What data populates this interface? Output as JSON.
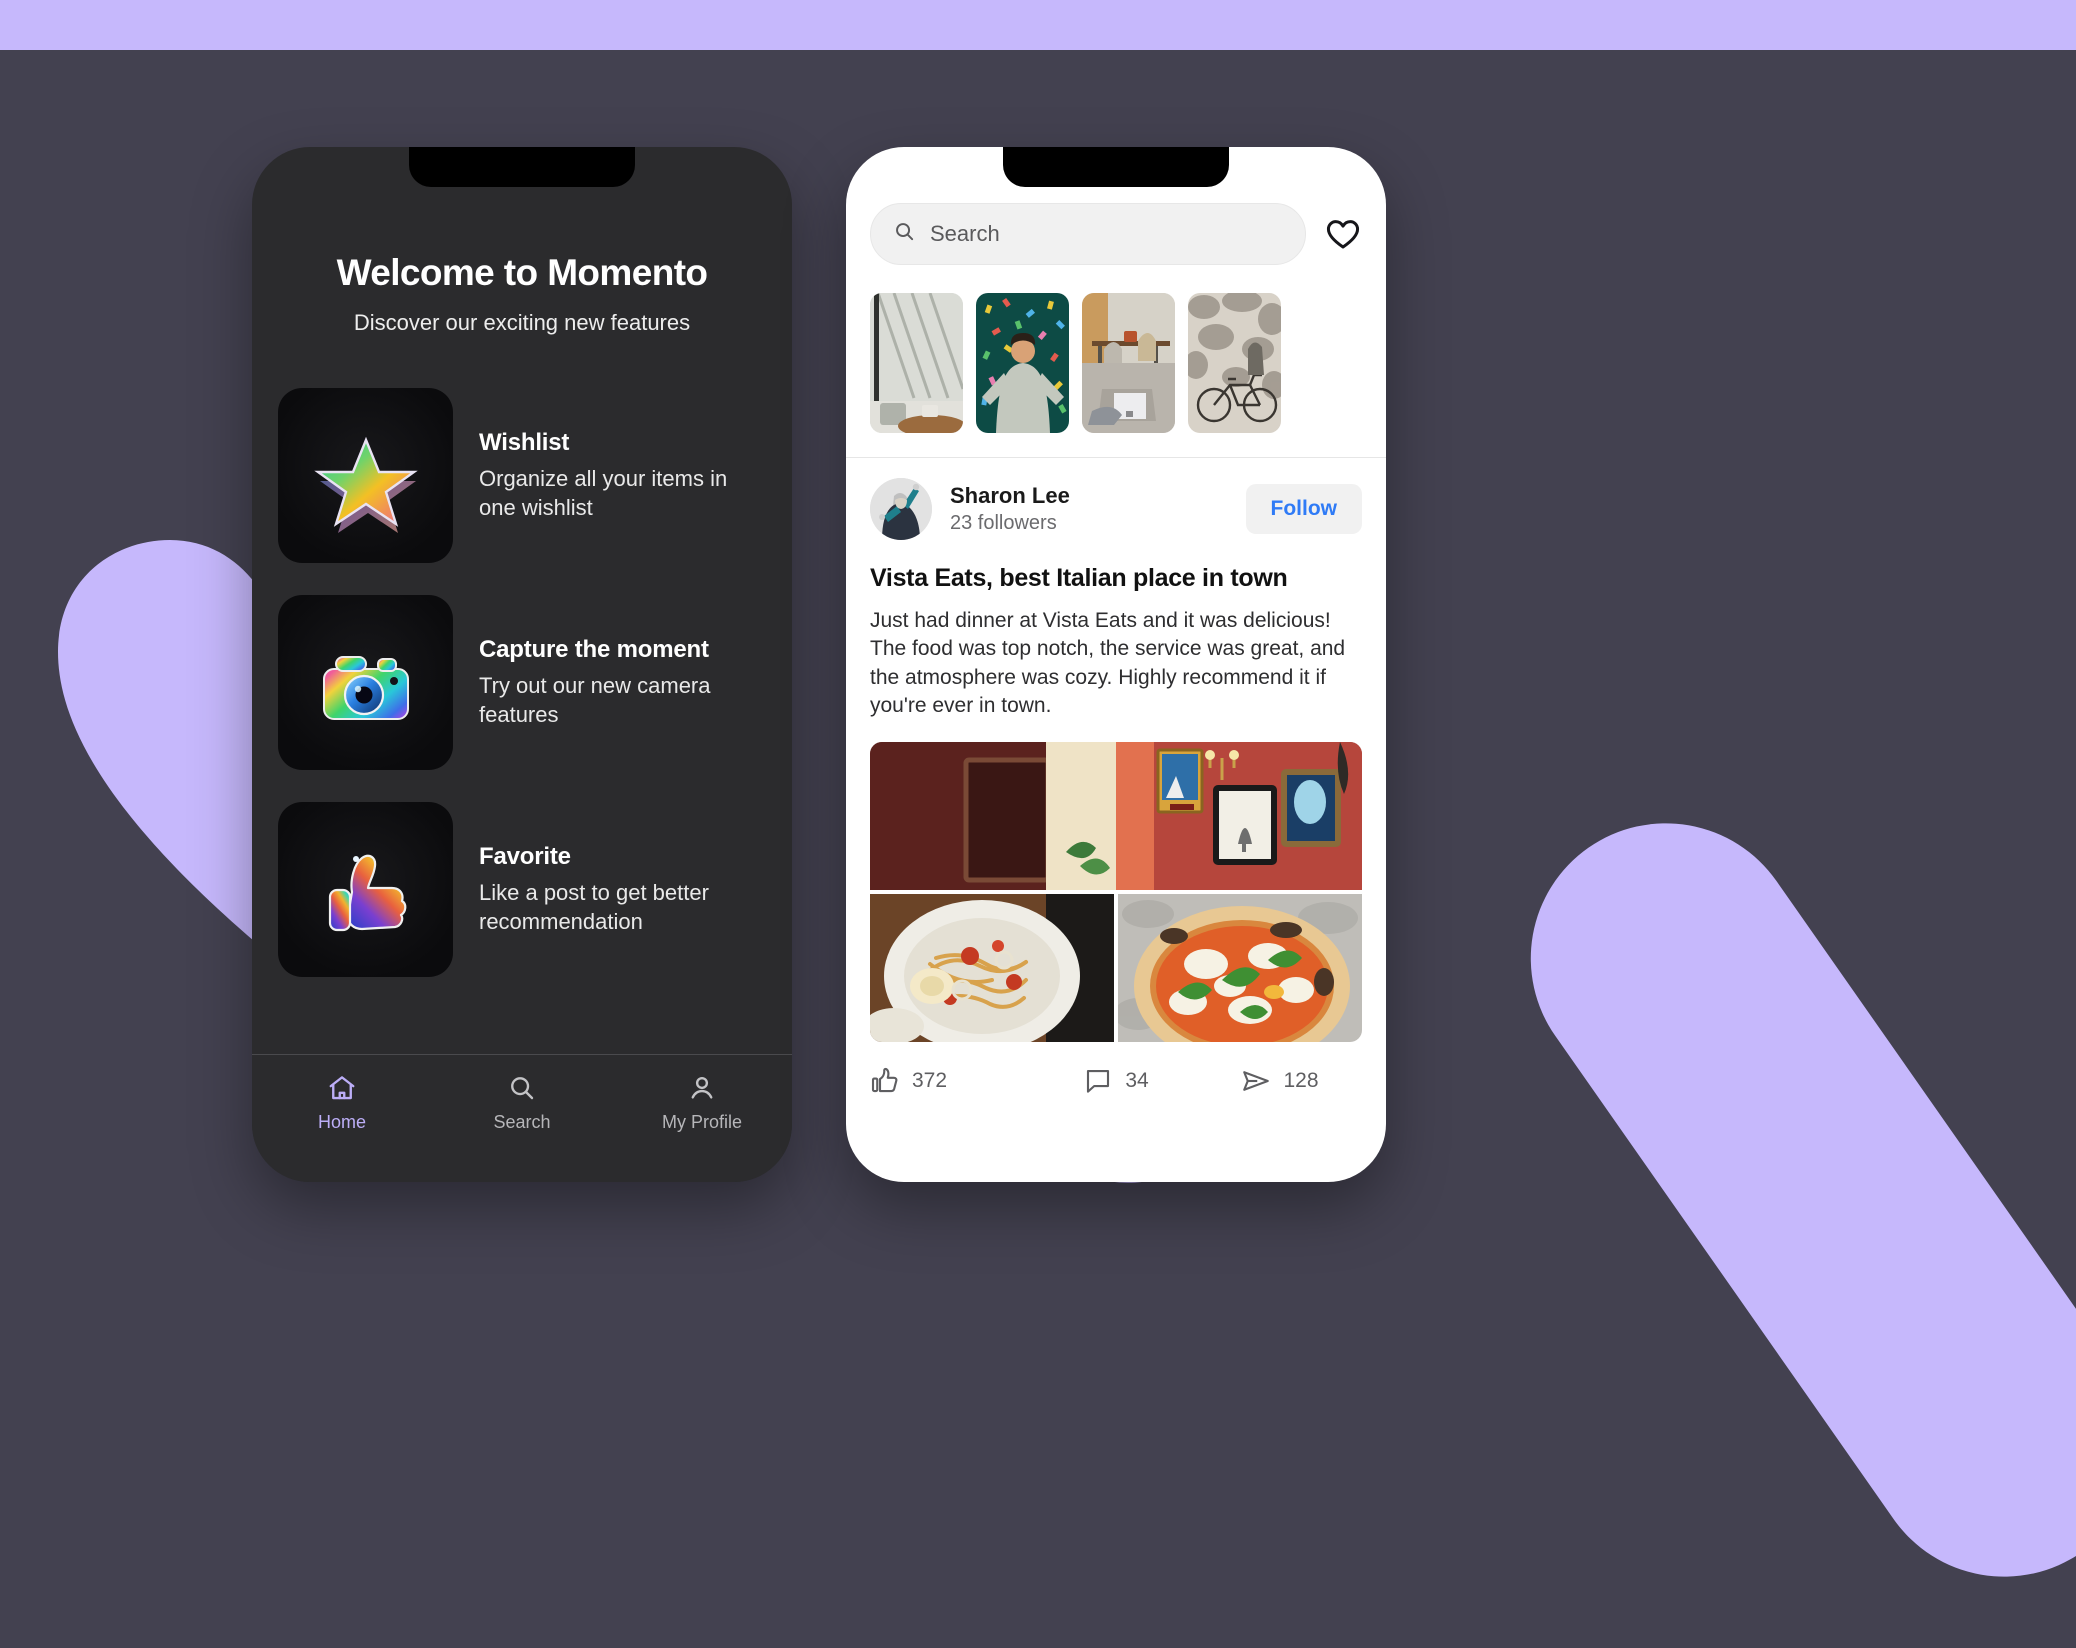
{
  "theme": {
    "page_background": "#434150",
    "accent_purple": "#C6B8FC",
    "dark_phone_bg": "#2B2B2D",
    "light_phone_bg": "#FFFFFF",
    "link_blue": "#2F7BF6",
    "active_tab": "#BCAEF7"
  },
  "onboarding": {
    "title": "Welcome to Momento",
    "subtitle": "Discover our exciting new features",
    "features": [
      {
        "icon": "star-3d-icon",
        "title": "Wishlist",
        "description": "Organize all your items in one wishlist"
      },
      {
        "icon": "camera-3d-icon",
        "title": "Capture the moment",
        "description": "Try out our new camera features"
      },
      {
        "icon": "thumbs-up-3d-icon",
        "title": "Favorite",
        "description": "Like a post to get better recommendation"
      }
    ],
    "tabs": [
      {
        "icon": "home-icon",
        "label": "Home",
        "active": true
      },
      {
        "icon": "search-icon",
        "label": "Search",
        "active": false
      },
      {
        "icon": "person-icon",
        "label": "My Profile",
        "active": false
      }
    ]
  },
  "feed": {
    "search": {
      "icon": "search-icon",
      "placeholder": "Search",
      "value": ""
    },
    "favorites_icon": "heart-outline-icon",
    "stories": [
      {
        "name": "story-window-shadows"
      },
      {
        "name": "story-confetti-person"
      },
      {
        "name": "story-cafe-interior"
      },
      {
        "name": "story-bicycle-wall"
      }
    ],
    "post": {
      "author": {
        "avatar": "avatar-sharon-lee",
        "name": "Sharon Lee",
        "followers": "23 followers"
      },
      "follow_label": "Follow",
      "title": "Vista Eats, best Italian place in town",
      "body": "Just had dinner at Vista Eats and it was delicious! The food was top notch, the service was great, and the atmosphere was cozy. Highly recommend it if you're ever in town.",
      "photos": [
        {
          "name": "photo-restaurant-wall-art"
        },
        {
          "name": "photo-seafood-pasta"
        },
        {
          "name": "photo-margherita-pizza"
        }
      ],
      "actions": [
        {
          "icon": "thumbs-up-icon",
          "count": "372"
        },
        {
          "icon": "comment-icon",
          "count": "34"
        },
        {
          "icon": "share-icon",
          "count": "128"
        }
      ]
    }
  }
}
